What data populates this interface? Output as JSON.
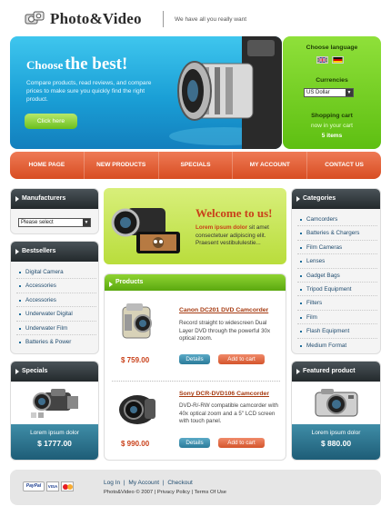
{
  "header": {
    "logo_text_1": "Photo",
    "logo_amp": "&",
    "logo_text_2": "Video",
    "tagline": "We have all you really want"
  },
  "hero": {
    "title_small": "Choose",
    "title_big": "the best!",
    "text": "Compare products, read reviews, and compare prices to make sure you quickly find the right product.",
    "button": "Click here"
  },
  "side_panel": {
    "language_title": "Choose language",
    "currencies_title": "Currencies",
    "currency_value": "US Dollar",
    "cart_title": "Shopping cart",
    "cart_line": "now in your cart",
    "cart_items": "5 items"
  },
  "nav": [
    "HOME PAGE",
    "NEW PRODUCTS",
    "SPECIALS",
    "MY ACCOUNT",
    "CONTACT US"
  ],
  "manufacturers": {
    "title": "Manufacturers",
    "select_value": "Please select"
  },
  "bestsellers": {
    "title": "Bestsellers",
    "items": [
      "Digital Camera",
      "Accessories",
      "Accessories",
      "Underwater Digital",
      "Underwater Film",
      "Batteries & Power"
    ]
  },
  "specials": {
    "title": "Specials",
    "caption": "Lorem ipsum dolor",
    "price": "$ 1777.00"
  },
  "welcome": {
    "title": "Welcome to us!",
    "lead": "Lorem ipsum dolor",
    "text": " sit amet consectetuer adipiscing elit. Praesent vestibululestie..."
  },
  "products": {
    "title": "Products",
    "items": [
      {
        "name": "Canon DC201 DVD Camcorder",
        "desc": "Record straight to widescreen Dual Layer DVD through the powerful 30x optical zoom.",
        "price": "$ 759.00",
        "details": "Details",
        "cart": "Add to cart"
      },
      {
        "name": "Sony DCR-DVD106 Camcorder",
        "desc": "DVD-R/-RW compatible camcorder with 40x optical zoom and a 5\" LCD screen with touch panel.",
        "price": "$ 990.00",
        "details": "Details",
        "cart": "Add to cart"
      }
    ]
  },
  "categories": {
    "title": "Categories",
    "items": [
      "Camcorders",
      "Batteries & Chargers",
      "Film Cameras",
      "Lenses",
      "Gadget Bags",
      "Tripod Equipment",
      "Filters",
      "Film",
      "Flash Equipment",
      "Medium Format"
    ]
  },
  "featured": {
    "title": "Featured product",
    "caption": "Lorem ipsum dolor",
    "price": "$ 880.00"
  },
  "footer": {
    "paypal": "PayPal",
    "visa": "VISA",
    "links": [
      "Log In",
      "My Account",
      "Checkout"
    ],
    "copy": "Photo&Video © 2007",
    "privacy": "Privacy Policy",
    "terms": "Terms Of Use"
  }
}
